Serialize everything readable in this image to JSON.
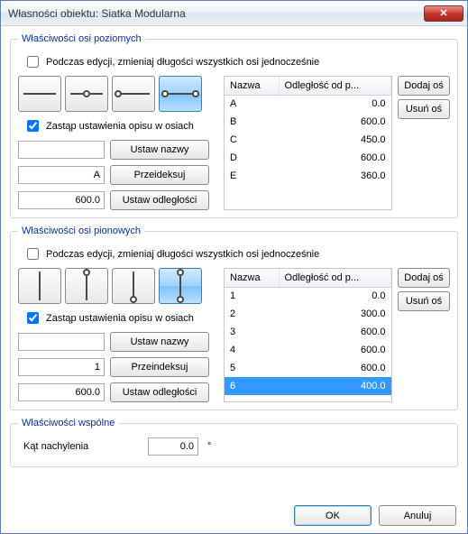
{
  "window": {
    "title": "Własności obiektu: Siatka Modularna"
  },
  "horiz": {
    "legend": "Właściwości osi poziomych",
    "edit_all_label": "Podczas edycji, zmieniaj długości wszystkich osi jednocześnie",
    "override_label": "Zastąp ustawienia opisu w osiach",
    "btn_set_names": "Ustaw nazwy",
    "btn_reindex": "Przeideksuj",
    "btn_set_dist": "Ustaw odległości",
    "name_input": "A",
    "dist_input": "600.0",
    "add_axis": "Dodaj oś",
    "del_axis": "Usuń oś",
    "col_name": "Nazwa",
    "col_dist": "Odległość od p...",
    "rows": [
      {
        "name": "A",
        "dist": "0.0"
      },
      {
        "name": "B",
        "dist": "600.0"
      },
      {
        "name": "C",
        "dist": "450.0"
      },
      {
        "name": "D",
        "dist": "600.0"
      },
      {
        "name": "E",
        "dist": "360.0"
      }
    ]
  },
  "vert": {
    "legend": "Właściwości osi pionowych",
    "edit_all_label": "Podczas edycji, zmieniaj długości wszystkich osi jednocześnie",
    "override_label": "Zastąp ustawienia opisu w osiach",
    "btn_set_names": "Ustaw nazwy",
    "btn_reindex": "Przeindeksuj",
    "btn_set_dist": "Ustaw odległości",
    "name_input": "1",
    "dist_input": "600.0",
    "add_axis": "Dodaj oś",
    "del_axis": "Usuń oś",
    "col_name": "Nazwa",
    "col_dist": "Odległość od p...",
    "rows": [
      {
        "name": "1",
        "dist": "0.0"
      },
      {
        "name": "2",
        "dist": "300.0"
      },
      {
        "name": "3",
        "dist": "600.0"
      },
      {
        "name": "4",
        "dist": "600.0"
      },
      {
        "name": "5",
        "dist": "600.0"
      },
      {
        "name": "6",
        "dist": "400.0"
      }
    ],
    "selected_index": 5
  },
  "common": {
    "legend": "Właściwości wspólne",
    "angle_label": "Kąt nachylenia",
    "angle_value": "0.0",
    "angle_unit": "°"
  },
  "footer": {
    "ok": "OK",
    "cancel": "Anuluj"
  }
}
